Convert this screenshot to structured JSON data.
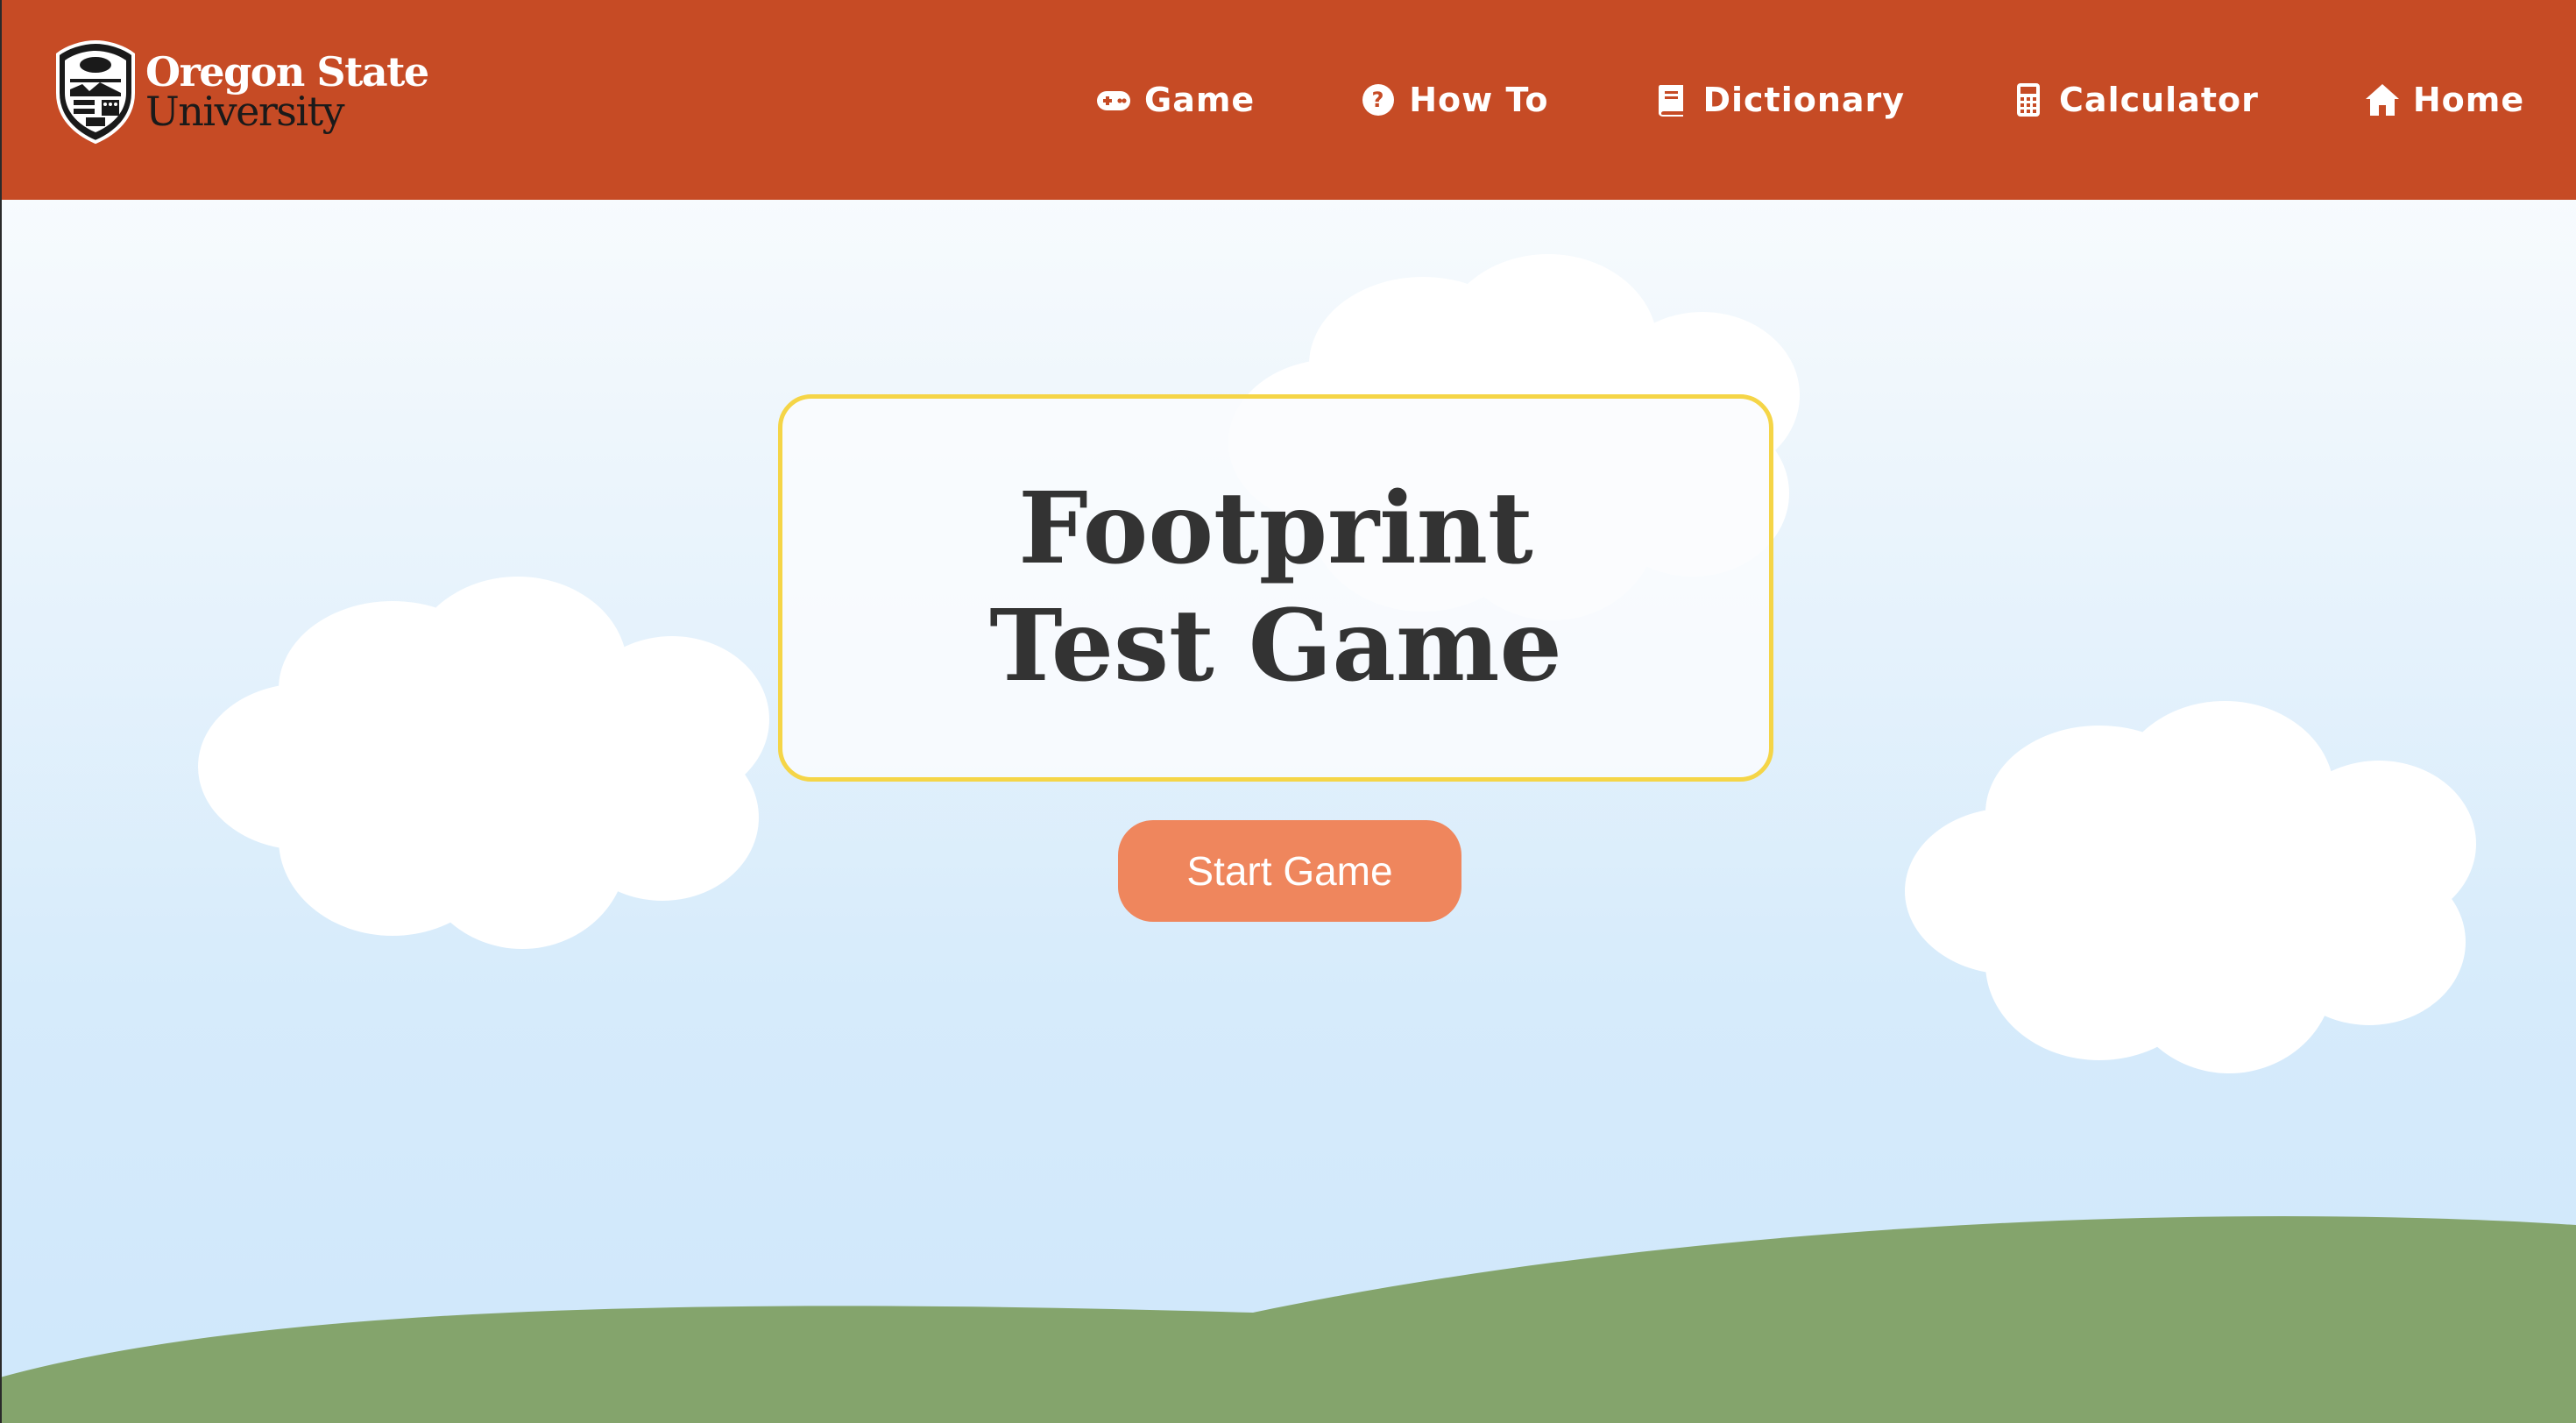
{
  "header": {
    "logo": {
      "line1": "Oregon State",
      "line2": "University",
      "icon": "osu-shield-icon"
    },
    "nav": [
      {
        "label": "Game",
        "icon": "gamepad-icon"
      },
      {
        "label": "How To",
        "icon": "question-circle-icon"
      },
      {
        "label": "Dictionary",
        "icon": "book-icon"
      },
      {
        "label": "Calculator",
        "icon": "calculator-icon"
      },
      {
        "label": "Home",
        "icon": "home-icon"
      }
    ]
  },
  "main": {
    "title": "Footprint Test Game",
    "start_button": "Start Game"
  },
  "colors": {
    "header": "#c64b25",
    "card_border": "#f5d547",
    "button": "#ef865d",
    "hills": "#84a46c",
    "sky": "#d6ebfb"
  }
}
